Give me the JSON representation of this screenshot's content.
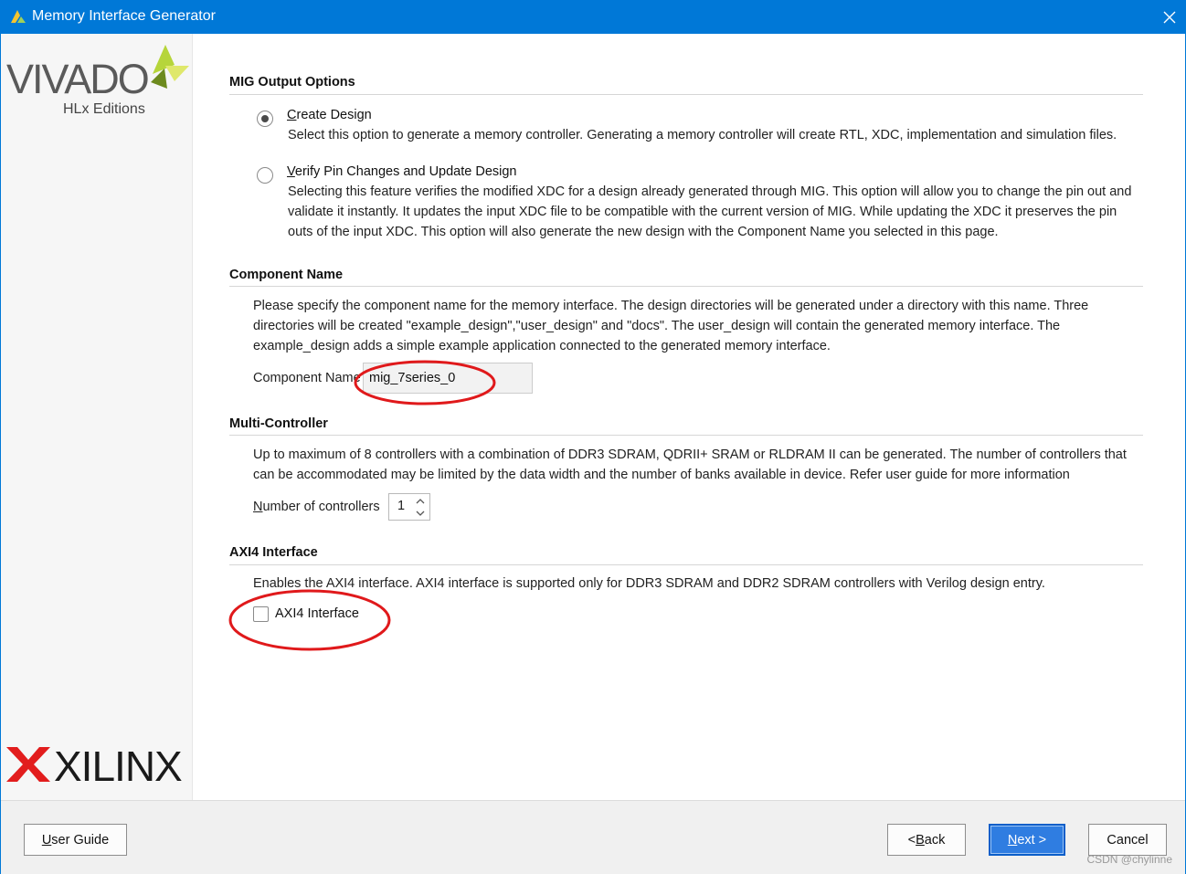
{
  "window": {
    "title": "Memory Interface Generator",
    "close_icon": "close-icon",
    "accent": "#0078d7"
  },
  "sidebar": {
    "brand_top": "VIVADO",
    "brand_top_sub": "HLx Editions",
    "brand_bottom": "XILINX"
  },
  "output_options": {
    "title": "MIG Output Options",
    "create_label_accel": "C",
    "create_label_rest": "reate Design",
    "create_desc": "Select this option to generate a memory controller. Generating a memory controller will create RTL, XDC, implementation and simulation files.",
    "verify_label_accel": "V",
    "verify_label_rest": "erify Pin Changes and Update Design",
    "verify_desc_1": "Selecting this feature verifies the modified XDC for a design already generated through MIG. This option will allow you to change the pin out and",
    "verify_desc_2": "validate it instantly. It updates the input XDC file to be compatible with the current version of MIG. While updating the XDC it preserves the pin",
    "verify_desc_3": "outs of the input XDC. This option will also generate the new design with the Component Name you selected in this page."
  },
  "component": {
    "title": "Component Name",
    "desc_1": "Please specify the component name for the memory interface. The design directories will be generated under a directory with this name. Three",
    "desc_2": "directories will be created \"example_design\",\"user_design\" and \"docs\". The user_design will contain the generated memory interface. The",
    "desc_3": "example_design adds a simple example application connected to the generated memory interface.",
    "label": "Component Name",
    "value": "mig_7series_0"
  },
  "multi_controller": {
    "title": "Multi-Controller",
    "desc_1": "Up to maximum of 8 controllers with a combination of DDR3 SDRAM, QDRII+ SRAM or RLDRAM II can be generated. The number of controllers that",
    "desc_2": "can be accommodated may be limited by the data width and the number of banks available in device. Refer user guide for more information",
    "label_accel": "N",
    "label_rest": "umber of controllers",
    "value": "1"
  },
  "axi4": {
    "title": "AXI4 Interface",
    "desc": "Enables the AXI4 interface. AXI4 interface is supported only for DDR3 SDRAM and DDR2 SDRAM controllers with Verilog design entry.",
    "checkbox_label": "AXI4 Interface"
  },
  "footer": {
    "user_guide_accel": "U",
    "user_guide_rest": "ser Guide",
    "back_prefix": "< ",
    "back_accel": "B",
    "back_rest": "ack",
    "next_accel": "N",
    "next_rest": "ext >",
    "cancel_label": "Cancel",
    "watermark": "CSDN @chylinne"
  },
  "colors": {
    "annotation_red": "#e0191b",
    "primary_button": "#2f7de1"
  }
}
